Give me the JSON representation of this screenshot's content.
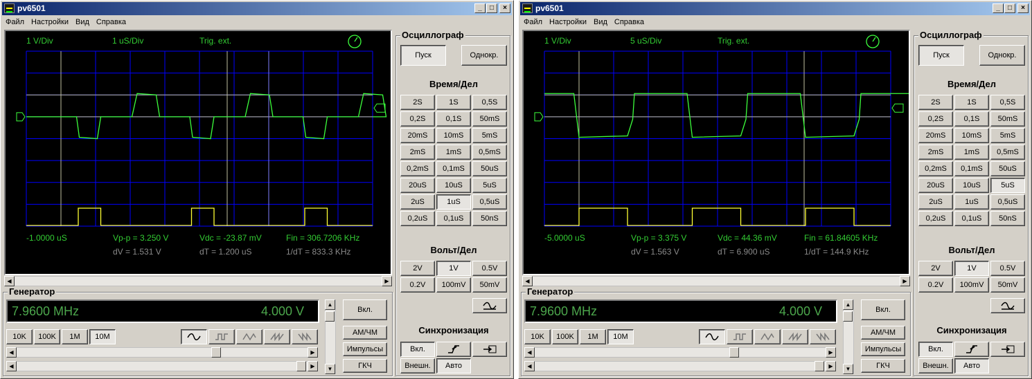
{
  "windows": [
    {
      "id": "w1",
      "title": "pv6501",
      "menu": [
        "Файл",
        "Настройки",
        "Вид",
        "Справка"
      ],
      "scope": {
        "volt_div": "1 V/Div",
        "time_div": "1 uS/Div",
        "trig": "Trig. ext.",
        "cursor_time": "-1.0000 uS",
        "vpp": "Vp-p = 3.250 V",
        "vdc": "Vdc = -23.87 mV",
        "fin": "Fin = 306.7206 KHz",
        "dv": "dV = 1.531 V",
        "dt": "dT = 1.200 uS",
        "inv_dt": "1/dT = 833.3 KHz",
        "selected_time": "1uS"
      },
      "signal": {
        "type": "pulse",
        "period_div": 3.27,
        "first_rise_div": 1.5,
        "high_width_div": 0.65
      }
    },
    {
      "id": "w2",
      "title": "pv6501",
      "menu": [
        "Файл",
        "Настройки",
        "Вид",
        "Справка"
      ],
      "scope": {
        "volt_div": "1 V/Div",
        "time_div": "5 uS/Div",
        "trig": "Trig. ext.",
        "cursor_time": "-5.0000 uS",
        "vpp": "Vp-p = 3.375 V",
        "vdc": "Vdc = 44.36 mV",
        "fin": "Fin = 61.84605 KHz",
        "dv": "dV = 1.563 V",
        "dt": "dT = 6.900 uS",
        "inv_dt": "1/dT = 144.9 KHz",
        "selected_time": "5uS"
      },
      "signal": {
        "type": "square",
        "period_div": 3.27,
        "first_rise_div": 1.0,
        "high_width_div": 1.4
      }
    }
  ],
  "panel": {
    "osc_label": "Осциллограф",
    "start": "Пуск",
    "single": "Однокр.",
    "time_label": "Время/Дел",
    "time_buttons": [
      "2S",
      "1S",
      "0,5S",
      "0,2S",
      "0,1S",
      "50mS",
      "20mS",
      "10mS",
      "5mS",
      "2mS",
      "1mS",
      "0,5mS",
      "0,2mS",
      "0,1mS",
      "50uS",
      "20uS",
      "10uS",
      "5uS",
      "2uS",
      "1uS",
      "0,5uS",
      "0,2uS",
      "0,1uS",
      "50nS"
    ],
    "volt_label": "Вольт/Дел",
    "volt_buttons": [
      "2V",
      "1V",
      "0.5V",
      "0.2V",
      "100mV",
      "50mV"
    ],
    "selected_volt": "1V",
    "sync_label": "Синхронизация",
    "sync_on": "Вкл.",
    "sync_ext": "Внешн.",
    "sync_auto": "Авто"
  },
  "generator": {
    "label": "Генератор",
    "freq": "7.9600 MHz",
    "ampl": "4.000 V",
    "ranges": [
      "10K",
      "100K",
      "1M",
      "10M"
    ],
    "selected_range": "10M",
    "on": "Вкл.",
    "am_fm": "AM/ЧМ",
    "pulses": "Импульсы",
    "gkch": "ГКЧ",
    "freq_slider": 0.67
  },
  "colors": {
    "trace": "#3cff3c",
    "pulse": "#ffff33",
    "grid": "#0000ff",
    "label": "#33cc33",
    "muted": "#8a8a8a",
    "lcd": "#4ca64c"
  }
}
